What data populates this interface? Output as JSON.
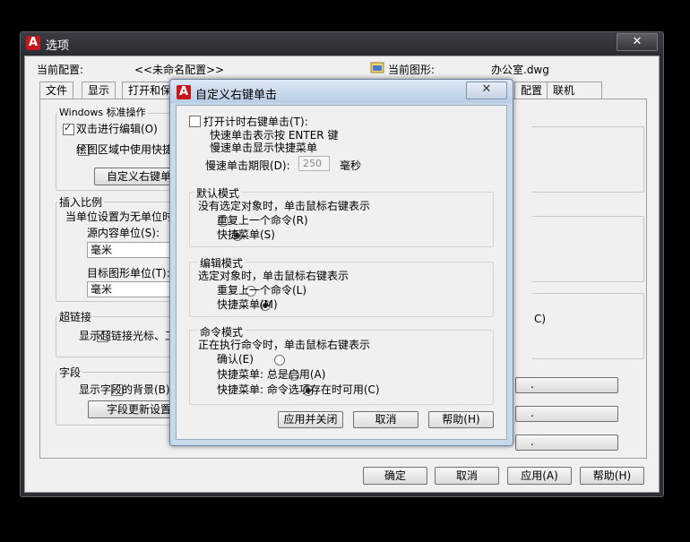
{
  "outer": {
    "title": "选项",
    "close": "✕",
    "current_profile_label": "当前配置:",
    "current_profile_value": "<<未命名配置>>",
    "current_drawing_label": "当前图形:",
    "current_drawing_value": "办公室.dwg",
    "tabs": [
      "文件",
      "显示",
      "打开和保",
      "配置",
      "联机"
    ],
    "groups": {
      "windows_ops": {
        "title": "Windows 标准操作",
        "dblclick_edit": "双击进行编辑(O)",
        "shortcut_menu": "绘图区域中使用快捷",
        "custom_button": "自定义右键单"
      },
      "insert_scale": {
        "title": "插入比例",
        "desc": "当单位设置为无单位时",
        "source_label": "源内容单位(S):",
        "source_value": "毫米",
        "target_label": "目标图形单位(T):",
        "target_value": "毫米"
      },
      "hyperlink": {
        "title": "超链接",
        "show_cursor": "显示超链接光标、工"
      },
      "field": {
        "title": "字段",
        "show_bg": "显示字段的背景(B)",
        "update_button": "字段更新设置"
      }
    },
    "right_fragment": "C)",
    "right_dots": [
      ".",
      ".",
      "."
    ],
    "bottom_buttons": [
      "确定",
      "取消",
      "应用(A)",
      "帮助(H)"
    ]
  },
  "dialog": {
    "title": "自定义右键单击",
    "close": "✕",
    "timed_right_click": "打开计时右键单击(T):",
    "quick_click": "快速单击表示按 ENTER 键",
    "slow_click": "慢速单击显示快捷菜单",
    "slow_limit_label": "慢速单击期限(D):",
    "slow_limit_value": "250",
    "slow_limit_unit": "毫秒",
    "default_mode": {
      "title": "默认模式",
      "desc": "没有选定对象时，单击鼠标右键表示",
      "options": [
        "重复上一个命令(R)",
        "快捷菜单(S)"
      ],
      "selected": 1
    },
    "edit_mode": {
      "title": "编辑模式",
      "desc": "选定对象时，单击鼠标右键表示",
      "options": [
        "重复上一个命令(L)",
        "快捷菜单(M)"
      ],
      "selected": 1
    },
    "command_mode": {
      "title": "命令模式",
      "desc": "正在执行命令时，单击鼠标右键表示",
      "options": [
        "确认(E)",
        "快捷菜单: 总是启用(A)",
        "快捷菜单: 命令选项存在时可用(C)"
      ],
      "selected": 2
    },
    "buttons": [
      "应用并关闭",
      "取消",
      "帮助(H)"
    ]
  }
}
